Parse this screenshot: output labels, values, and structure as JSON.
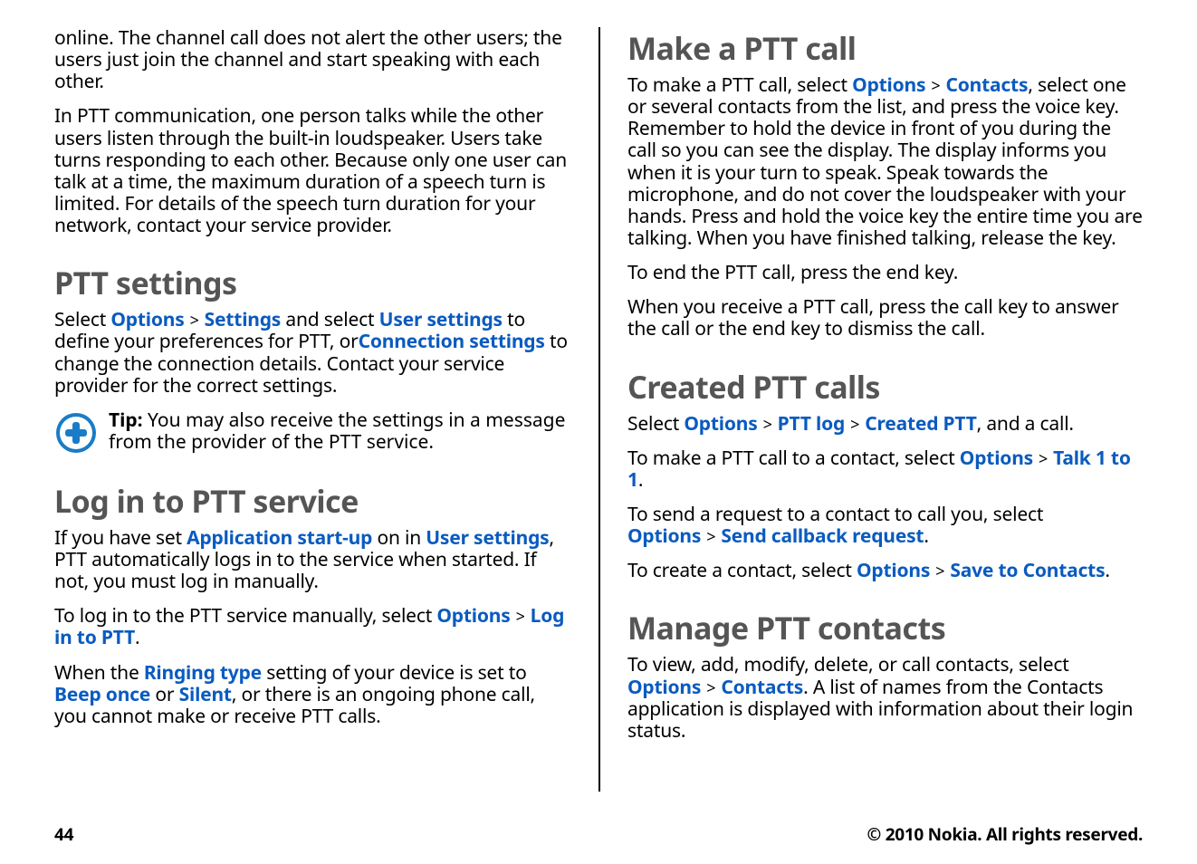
{
  "left": {
    "p1": "online. The channel call does not alert the other users; the users just join the channel and start speaking with each other.",
    "p2": "In PTT communication, one person talks while the other users listen through the built-in loudspeaker. Users take turns responding to each other. Because only one user can talk at a time, the maximum duration of a speech turn is limited. For details of the speech turn duration for your network, contact your service provider.",
    "h_ptt_settings": "PTT settings",
    "ps": {
      "a": "Select ",
      "options": "Options",
      "gt1": " > ",
      "settings": "Settings",
      "b": " and select ",
      "user_settings": "User settings",
      "c": " to define your preferences for PTT, or",
      "conn": "Connection settings",
      "d": " to change the connection details. Contact your service provider for the correct settings."
    },
    "tip_label": "Tip:",
    "tip_text": " You may also receive the settings in a message from the provider of the PTT service.",
    "h_login": "Log in to PTT service",
    "login_p1": {
      "a": "If you have set ",
      "app_startup": "Application start-up",
      "b": " on in ",
      "user_settings": "User settings",
      "c": ", PTT automatically logs in to the service when started. If not, you must log in manually."
    },
    "login_p2": {
      "a": "To log in to the PTT service manually, select ",
      "options": "Options",
      "gt": " > ",
      "login": "Log in to PTT",
      "end": "."
    },
    "login_p3": {
      "a": "When the ",
      "ringing": "Ringing type",
      "b": " setting of your device is set to ",
      "beep": "Beep once",
      "c": " or ",
      "silent": "Silent",
      "d": ", or there is an ongoing phone call, you cannot make or receive PTT calls."
    }
  },
  "right": {
    "h_make": "Make a PTT call",
    "make_p1": {
      "a": "To make a PTT call, select ",
      "options": "Options",
      "gt": " > ",
      "contacts": "Contacts",
      "b": ", select one or several contacts from the list, and press the voice key. Remember to hold the device in front of you during the call so you can see the display. The display informs you when it is your turn to speak. Speak towards the microphone, and do not cover the loudspeaker with your hands. Press and hold the voice key the entire time you are talking. When you have finished talking, release the key."
    },
    "make_p2": "To end the PTT call, press the end key.",
    "make_p3": "When you receive a PTT call, press the call key to answer the call or the end key to dismiss the call.",
    "h_created": "Created PTT calls",
    "created_p1": {
      "a": "Select ",
      "options": "Options",
      "gt1": " > ",
      "pttlog": "PTT log",
      "gt2": " > ",
      "created": "Created PTT",
      "b": ", and a call."
    },
    "created_p2": {
      "a": "To make a PTT call to a contact, select ",
      "options": "Options",
      "gt": " > ",
      "talk": "Talk 1 to 1",
      "end": "."
    },
    "created_p3": {
      "a": "To send a request to a contact to call you, select ",
      "options": "Options",
      "gt": " > ",
      "cb": "Send callback request",
      "end": "."
    },
    "created_p4": {
      "a": "To create a contact, select ",
      "options": "Options",
      "gt": " > ",
      "save": "Save to Contacts",
      "end": "."
    },
    "h_manage": "Manage PTT contacts",
    "manage_p1": {
      "a": "To view, add, modify, delete, or call contacts, select ",
      "options": "Options",
      "gt": " > ",
      "contacts": "Contacts",
      "b": ". A list of names from the Contacts application is displayed with information about their login status."
    }
  },
  "footer": {
    "page": "44",
    "copyright": "© 2010 Nokia. All rights reserved."
  }
}
